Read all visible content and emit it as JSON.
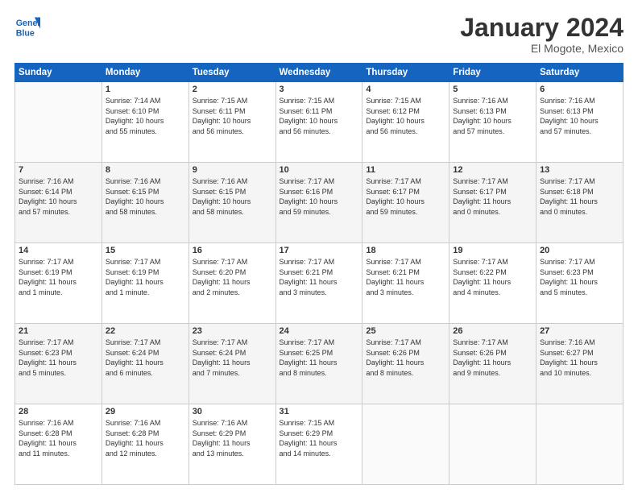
{
  "header": {
    "logo_line1": "General",
    "logo_line2": "Blue",
    "month_title": "January 2024",
    "location": "El Mogote, Mexico"
  },
  "days_of_week": [
    "Sunday",
    "Monday",
    "Tuesday",
    "Wednesday",
    "Thursday",
    "Friday",
    "Saturday"
  ],
  "weeks": [
    [
      {
        "num": "",
        "info": ""
      },
      {
        "num": "1",
        "info": "Sunrise: 7:14 AM\nSunset: 6:10 PM\nDaylight: 10 hours\nand 55 minutes."
      },
      {
        "num": "2",
        "info": "Sunrise: 7:15 AM\nSunset: 6:11 PM\nDaylight: 10 hours\nand 56 minutes."
      },
      {
        "num": "3",
        "info": "Sunrise: 7:15 AM\nSunset: 6:11 PM\nDaylight: 10 hours\nand 56 minutes."
      },
      {
        "num": "4",
        "info": "Sunrise: 7:15 AM\nSunset: 6:12 PM\nDaylight: 10 hours\nand 56 minutes."
      },
      {
        "num": "5",
        "info": "Sunrise: 7:16 AM\nSunset: 6:13 PM\nDaylight: 10 hours\nand 57 minutes."
      },
      {
        "num": "6",
        "info": "Sunrise: 7:16 AM\nSunset: 6:13 PM\nDaylight: 10 hours\nand 57 minutes."
      }
    ],
    [
      {
        "num": "7",
        "info": "Sunrise: 7:16 AM\nSunset: 6:14 PM\nDaylight: 10 hours\nand 57 minutes."
      },
      {
        "num": "8",
        "info": "Sunrise: 7:16 AM\nSunset: 6:15 PM\nDaylight: 10 hours\nand 58 minutes."
      },
      {
        "num": "9",
        "info": "Sunrise: 7:16 AM\nSunset: 6:15 PM\nDaylight: 10 hours\nand 58 minutes."
      },
      {
        "num": "10",
        "info": "Sunrise: 7:17 AM\nSunset: 6:16 PM\nDaylight: 10 hours\nand 59 minutes."
      },
      {
        "num": "11",
        "info": "Sunrise: 7:17 AM\nSunset: 6:17 PM\nDaylight: 10 hours\nand 59 minutes."
      },
      {
        "num": "12",
        "info": "Sunrise: 7:17 AM\nSunset: 6:17 PM\nDaylight: 11 hours\nand 0 minutes."
      },
      {
        "num": "13",
        "info": "Sunrise: 7:17 AM\nSunset: 6:18 PM\nDaylight: 11 hours\nand 0 minutes."
      }
    ],
    [
      {
        "num": "14",
        "info": "Sunrise: 7:17 AM\nSunset: 6:19 PM\nDaylight: 11 hours\nand 1 minute."
      },
      {
        "num": "15",
        "info": "Sunrise: 7:17 AM\nSunset: 6:19 PM\nDaylight: 11 hours\nand 1 minute."
      },
      {
        "num": "16",
        "info": "Sunrise: 7:17 AM\nSunset: 6:20 PM\nDaylight: 11 hours\nand 2 minutes."
      },
      {
        "num": "17",
        "info": "Sunrise: 7:17 AM\nSunset: 6:21 PM\nDaylight: 11 hours\nand 3 minutes."
      },
      {
        "num": "18",
        "info": "Sunrise: 7:17 AM\nSunset: 6:21 PM\nDaylight: 11 hours\nand 3 minutes."
      },
      {
        "num": "19",
        "info": "Sunrise: 7:17 AM\nSunset: 6:22 PM\nDaylight: 11 hours\nand 4 minutes."
      },
      {
        "num": "20",
        "info": "Sunrise: 7:17 AM\nSunset: 6:23 PM\nDaylight: 11 hours\nand 5 minutes."
      }
    ],
    [
      {
        "num": "21",
        "info": "Sunrise: 7:17 AM\nSunset: 6:23 PM\nDaylight: 11 hours\nand 5 minutes."
      },
      {
        "num": "22",
        "info": "Sunrise: 7:17 AM\nSunset: 6:24 PM\nDaylight: 11 hours\nand 6 minutes."
      },
      {
        "num": "23",
        "info": "Sunrise: 7:17 AM\nSunset: 6:24 PM\nDaylight: 11 hours\nand 7 minutes."
      },
      {
        "num": "24",
        "info": "Sunrise: 7:17 AM\nSunset: 6:25 PM\nDaylight: 11 hours\nand 8 minutes."
      },
      {
        "num": "25",
        "info": "Sunrise: 7:17 AM\nSunset: 6:26 PM\nDaylight: 11 hours\nand 8 minutes."
      },
      {
        "num": "26",
        "info": "Sunrise: 7:17 AM\nSunset: 6:26 PM\nDaylight: 11 hours\nand 9 minutes."
      },
      {
        "num": "27",
        "info": "Sunrise: 7:16 AM\nSunset: 6:27 PM\nDaylight: 11 hours\nand 10 minutes."
      }
    ],
    [
      {
        "num": "28",
        "info": "Sunrise: 7:16 AM\nSunset: 6:28 PM\nDaylight: 11 hours\nand 11 minutes."
      },
      {
        "num": "29",
        "info": "Sunrise: 7:16 AM\nSunset: 6:28 PM\nDaylight: 11 hours\nand 12 minutes."
      },
      {
        "num": "30",
        "info": "Sunrise: 7:16 AM\nSunset: 6:29 PM\nDaylight: 11 hours\nand 13 minutes."
      },
      {
        "num": "31",
        "info": "Sunrise: 7:15 AM\nSunset: 6:29 PM\nDaylight: 11 hours\nand 14 minutes."
      },
      {
        "num": "",
        "info": ""
      },
      {
        "num": "",
        "info": ""
      },
      {
        "num": "",
        "info": ""
      }
    ]
  ]
}
